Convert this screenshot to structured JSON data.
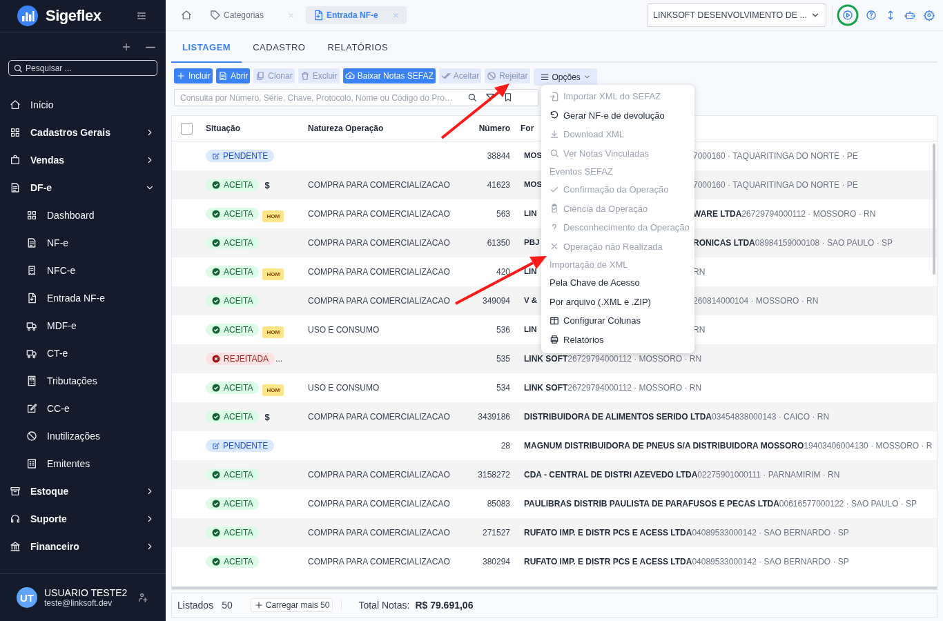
{
  "sidebar": {
    "brand": "Sigeflex",
    "search": {
      "placeholder": "Pesquisar ..."
    },
    "items": [
      {
        "label": "Início"
      },
      {
        "label": "Cadastros Gerais",
        "expanded": false
      },
      {
        "label": "Vendas",
        "expanded": false
      },
      {
        "label": "DF-e",
        "expanded": true,
        "children": [
          {
            "label": "Dashboard"
          },
          {
            "label": "NF-e"
          },
          {
            "label": "NFC-e"
          },
          {
            "label": "Entrada NF-e"
          },
          {
            "label": "MDF-e"
          },
          {
            "label": "CT-e"
          },
          {
            "label": "Tributações"
          },
          {
            "label": "CC-e"
          },
          {
            "label": "Inutilizações"
          },
          {
            "label": "Emitentes"
          }
        ]
      },
      {
        "label": "Estoque",
        "expanded": false
      },
      {
        "label": "Suporte",
        "expanded": false
      },
      {
        "label": "Financeiro",
        "expanded": false
      }
    ],
    "user": {
      "initials": "UT",
      "name": "USUARIO TESTE2",
      "email": "teste@linksoft.dev"
    }
  },
  "tabs": [
    {
      "kind": "home",
      "selected": false
    },
    {
      "kind": "page",
      "label": "Categorias",
      "selected": false
    },
    {
      "kind": "page",
      "label": "Entrada NF-e",
      "selected": true
    }
  ],
  "company_select": {
    "value": "LINKSOFT DESENVOLVIMENTO DE ..."
  },
  "subtabs": [
    {
      "label": "LISTAGEM",
      "selected": true
    },
    {
      "label": "CADASTRO",
      "selected": false
    },
    {
      "label": "RELATÓRIOS",
      "selected": false
    }
  ],
  "toolbar": [
    {
      "label": "Incluir",
      "disabled": false
    },
    {
      "label": "Abrir",
      "disabled": false
    },
    {
      "label": "Clonar",
      "disabled": true
    },
    {
      "label": "Excluir",
      "disabled": true
    },
    {
      "label": "Baixar Notas SEFAZ",
      "disabled": false
    },
    {
      "label": "Aceitar",
      "disabled": true
    },
    {
      "label": "Rejeitar",
      "disabled": true
    }
  ],
  "options_button": {
    "label": "Opções"
  },
  "search": {
    "placeholder": "Consulta por Número, Série, Chave, Protocolo, Nome ou Código do Pro…"
  },
  "table": {
    "select_all": {
      "checked": false
    },
    "columns": [
      "Situação",
      "Natureza Operação",
      "Número",
      "For"
    ],
    "rows": [
      {
        "status": {
          "kind": "pending",
          "label": "PENDENTE"
        },
        "nature": "",
        "number": "38844",
        "supplier": {
          "lead": "MOS",
          "detail": "7000160 · TAQUARITINGA DO NORTE · PE"
        }
      },
      {
        "status": {
          "kind": "accepted",
          "label": "ACEITA"
        },
        "extra": {
          "kind": "dollar",
          "label": "$"
        },
        "nature": "COMPRA PARA COMERCIALIZACAO",
        "number": "41623",
        "supplier": {
          "lead": "MOS",
          "detail": "7000160 · TAQUARITINGA DO NORTE · PE"
        }
      },
      {
        "status": {
          "kind": "accepted",
          "label": "ACEITA"
        },
        "extra": {
          "kind": "hom",
          "label": "HOM"
        },
        "nature": "COMPRA PARA COMERCIALIZACAO",
        "number": "563",
        "supplier": {
          "lead": "LIN",
          "name": "WARE LTDA",
          "detail": "26729794000112 · MOSSORO · RN"
        }
      },
      {
        "status": {
          "kind": "accepted",
          "label": "ACEITA"
        },
        "nature": "COMPRA PARA COMERCIALIZACAO",
        "number": "61350",
        "supplier": {
          "lead": "PBJ",
          "name": "RONICAS LTDA",
          "detail": "08984159000108 · SAO PAULO · SP"
        }
      },
      {
        "status": {
          "kind": "accepted",
          "label": "ACEITA"
        },
        "extra": {
          "kind": "hom",
          "label": "HOM"
        },
        "nature": "COMPRA PARA COMERCIALIZACAO",
        "number": "420",
        "supplier": {
          "lead": "LIN",
          "detail": "RN"
        }
      },
      {
        "status": {
          "kind": "accepted",
          "label": "ACEITA"
        },
        "nature": "COMPRA PARA COMERCIALIZACAO",
        "number": "349094",
        "supplier": {
          "lead": "V &",
          "detail": "260814000104 · MOSSORO · RN"
        }
      },
      {
        "status": {
          "kind": "accepted",
          "label": "ACEITA"
        },
        "extra": {
          "kind": "hom",
          "label": "HOM"
        },
        "nature": "USO E CONSUMO",
        "number": "536",
        "supplier": {
          "lead": "LIN",
          "detail": "RN"
        }
      },
      {
        "status": {
          "kind": "rejected",
          "label": "REJEITADA"
        },
        "extra": {
          "kind": "more",
          "label": "..."
        },
        "nature": "",
        "number": "535",
        "supplier": {
          "name": "LINK SOFT",
          "detail": "26729794000112 · MOSSORO · RN"
        }
      },
      {
        "status": {
          "kind": "accepted",
          "label": "ACEITA"
        },
        "extra": {
          "kind": "hom",
          "label": "HOM"
        },
        "nature": "USO E CONSUMO",
        "number": "534",
        "supplier": {
          "name": "LINK SOFT",
          "detail": "26729794000112 · MOSSORO · RN"
        }
      },
      {
        "status": {
          "kind": "accepted",
          "label": "ACEITA"
        },
        "extra": {
          "kind": "dollar",
          "label": "$"
        },
        "nature": "COMPRA PARA COMERCIALIZACAO",
        "number": "3439186",
        "supplier": {
          "name": "DISTRIBUIDORA DE ALIMENTOS SERIDO LTDA",
          "detail": "03454838000143 · CAICO · RN"
        }
      },
      {
        "status": {
          "kind": "pending",
          "label": "PENDENTE"
        },
        "nature": "",
        "number": "28",
        "supplier": {
          "name": "MAGNUM DISTRIBUIDORA DE PNEUS S/A DISTRIBUIDORA MOSSORO",
          "detail": "19403406004130 · MOSSORO · R"
        }
      },
      {
        "status": {
          "kind": "accepted",
          "label": "ACEITA"
        },
        "nature": "COMPRA PARA COMERCIALIZACAO",
        "number": "3158272",
        "supplier": {
          "name": "CDA - CENTRAL DE DISTRI AZEVEDO LTDA",
          "detail": "02275901000111 · PARNAMIRIM · RN"
        }
      },
      {
        "status": {
          "kind": "accepted",
          "label": "ACEITA"
        },
        "nature": "COMPRA PARA COMERCIALIZACAO",
        "number": "85083",
        "supplier": {
          "name": "PAULIBRAS DISTRIB PAULISTA DE PARAFUSOS E PECAS LTDA",
          "detail": "00616577000122 · SAO PAULO · SP"
        }
      },
      {
        "status": {
          "kind": "accepted",
          "label": "ACEITA"
        },
        "nature": "COMPRA PARA COMERCIALIZACAO",
        "number": "271527",
        "supplier": {
          "name": "RUFATO IMP. E DISTR PCS E ACESS LTDA",
          "detail": "04089533000142 · SAO BERNARDO · SP"
        }
      },
      {
        "status": {
          "kind": "accepted",
          "label": "ACEITA"
        },
        "nature": "COMPRA PARA COMERCIALIZACAO",
        "number": "380294",
        "supplier": {
          "name": "RUFATO IMP. E DISTR PCS E ACESS LTDA",
          "detail": "04089533000142 · SAO BERNARDO · SP"
        }
      }
    ]
  },
  "options_menu": {
    "items": [
      {
        "kind": "item",
        "label": "Importar XML do SEFAZ",
        "disabled": true
      },
      {
        "kind": "item",
        "label": "Gerar NF-e de devolução",
        "disabled": false
      },
      {
        "kind": "item",
        "label": "Download XML",
        "disabled": true
      },
      {
        "kind": "item",
        "label": "Ver Notas Vinculadas",
        "disabled": true
      },
      {
        "kind": "header",
        "label": "Eventos SEFAZ"
      },
      {
        "kind": "item",
        "label": "Confirmação da Operação",
        "disabled": true
      },
      {
        "kind": "item",
        "label": "Ciência da Operação",
        "disabled": true
      },
      {
        "kind": "item",
        "label": "Desconhecimento da Operação",
        "disabled": true
      },
      {
        "kind": "item",
        "label": "Operação não Realizada",
        "disabled": true
      },
      {
        "kind": "header",
        "label": "Importação de XML"
      },
      {
        "kind": "item",
        "label": "Pela Chave de Acesso",
        "disabled": false
      },
      {
        "kind": "item",
        "label": "Por arquivo (.XML e .ZIP)",
        "disabled": false
      },
      {
        "kind": "item",
        "label": "Configurar Colunas",
        "disabled": false
      },
      {
        "kind": "item",
        "label": "Relatórios",
        "disabled": false
      }
    ]
  },
  "footer": {
    "listed_label": "Listados",
    "listed_count": "50",
    "load_more": "Carregar mais 50",
    "total_label": "Total Notas:",
    "total_value": "R$ 79.691,06"
  }
}
